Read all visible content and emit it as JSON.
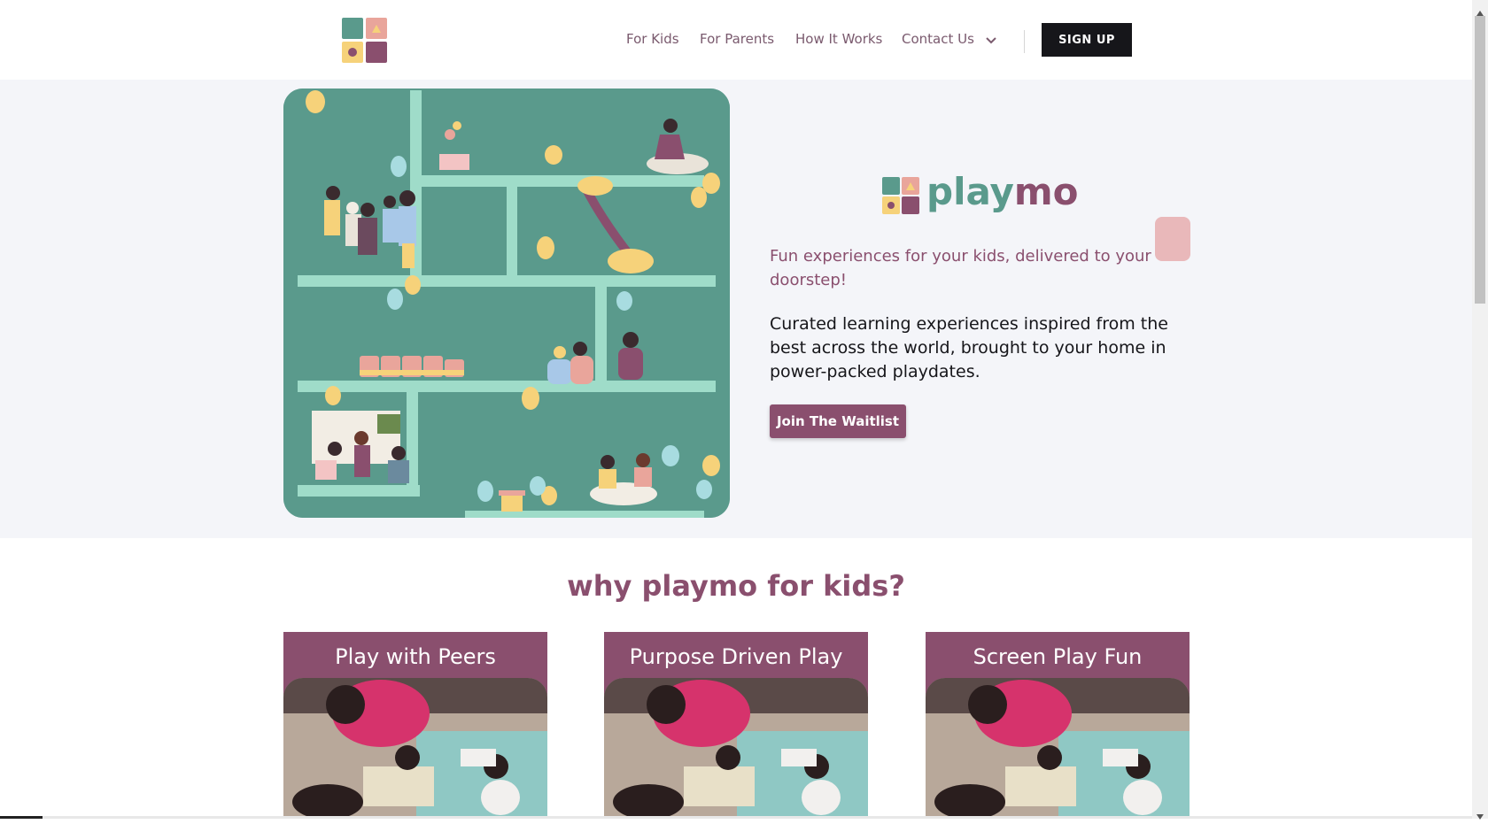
{
  "nav": {
    "items": [
      {
        "label": "For Kids"
      },
      {
        "label": "For Parents"
      },
      {
        "label": "How It Works"
      },
      {
        "label": "Contact Us"
      }
    ],
    "signup_label": "SIGN UP"
  },
  "hero": {
    "brand_play": "play",
    "brand_mo": "mo",
    "tagline": "Fun experiences for your kids, delivered to your doorstep!",
    "description": "Curated learning experiences inspired from the best across the world, brought to your home in power-packed playdates.",
    "cta_label": "Join The Waitlist"
  },
  "why": {
    "title": "why playmo for kids?",
    "cards": [
      {
        "title": "Play with Peers"
      },
      {
        "title": "Purpose Driven Play"
      },
      {
        "title": "Screen Play Fun"
      }
    ]
  },
  "colors": {
    "brand_purple": "#8a4f6e",
    "brand_teal": "#5a9a8c",
    "brand_yellow": "#f6d27a",
    "brand_pink": "#e9a59b",
    "dark": "#16161a",
    "hero_bg": "#f4f5f9"
  },
  "icons": {
    "dropdown": "chevron-down-icon"
  }
}
